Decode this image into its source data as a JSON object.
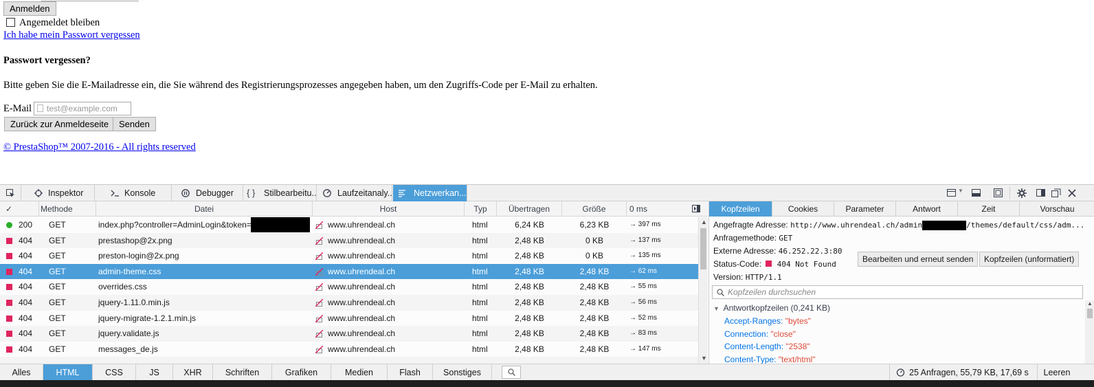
{
  "page": {
    "login_button": "Anmelden",
    "remember_label": "Angemeldet bleiben",
    "forgot_link": "Ich habe mein Passwort vergessen",
    "forgot_heading": "Passwort vergessen?",
    "forgot_text": "Bitte geben Sie die E-Mailadresse ein, die Sie während des Registrierungsprozesses angegeben haben, um den Zugriffs-Code per E-Mail zu erhalten.",
    "email_label": "E-Mail",
    "email_placeholder": "test@example.com",
    "back_button": "Zurück zur Anmeldeseite",
    "send_button": "Senden",
    "footer_link": "© PrestaShop™ 2007-2016 - All rights reserved"
  },
  "devtools": {
    "tabs": [
      "Inspektor",
      "Konsole",
      "Debugger",
      "Stilbearbeitu...",
      "Laufzeitanaly...",
      "Netzwerkan..."
    ],
    "active_tab": "Netzwerkan...",
    "columns": {
      "check": "✓",
      "method": "Methode",
      "file": "Datei",
      "host": "Host",
      "type": "Typ",
      "transferred": "Übertragen",
      "size": "Größe",
      "waterfall": "0 ms"
    },
    "requests": [
      {
        "status": "200",
        "method": "GET",
        "file": "index.php?controller=AdminLogin&token=",
        "host": "www.uhrendeal.ch",
        "type": "html",
        "transferred": "6,24 KB",
        "size": "6,23 KB",
        "time": "→ 397 ms"
      },
      {
        "status": "404",
        "method": "GET",
        "file": "prestashop@2x.png",
        "host": "www.uhrendeal.ch",
        "type": "html",
        "transferred": "2,48 KB",
        "size": "0 KB",
        "time": "→ 137 ms"
      },
      {
        "status": "404",
        "method": "GET",
        "file": "preston-login@2x.png",
        "host": "www.uhrendeal.ch",
        "type": "html",
        "transferred": "2,48 KB",
        "size": "0 KB",
        "time": "→ 135 ms"
      },
      {
        "status": "404",
        "method": "GET",
        "file": "admin-theme.css",
        "host": "www.uhrendeal.ch",
        "type": "html",
        "transferred": "2,48 KB",
        "size": "2,48 KB",
        "time": "→ 62 ms"
      },
      {
        "status": "404",
        "method": "GET",
        "file": "overrides.css",
        "host": "www.uhrendeal.ch",
        "type": "html",
        "transferred": "2,48 KB",
        "size": "2,48 KB",
        "time": "→ 55 ms"
      },
      {
        "status": "404",
        "method": "GET",
        "file": "jquery-1.11.0.min.js",
        "host": "www.uhrendeal.ch",
        "type": "html",
        "transferred": "2,48 KB",
        "size": "2,48 KB",
        "time": "→ 56 ms"
      },
      {
        "status": "404",
        "method": "GET",
        "file": "jquery-migrate-1.2.1.min.js",
        "host": "www.uhrendeal.ch",
        "type": "html",
        "transferred": "2,48 KB",
        "size": "2,48 KB",
        "time": "→ 52 ms"
      },
      {
        "status": "404",
        "method": "GET",
        "file": "jquery.validate.js",
        "host": "www.uhrendeal.ch",
        "type": "html",
        "transferred": "2,48 KB",
        "size": "2,48 KB",
        "time": "→ 83 ms"
      },
      {
        "status": "404",
        "method": "GET",
        "file": "messages_de.js",
        "host": "www.uhrendeal.ch",
        "type": "html",
        "transferred": "2,48 KB",
        "size": "2,48 KB",
        "time": "→ 147 ms"
      }
    ],
    "details": {
      "tabs": [
        "Kopfzeilen",
        "Cookies",
        "Parameter",
        "Antwort",
        "Zeit",
        "Vorschau"
      ],
      "active_tab": "Kopfzeilen",
      "request_url_label": "Angefragte Adresse:",
      "request_url_start": "http://www.uhrendeal.ch/admin",
      "request_url_end": "/themes/default/css/adm...",
      "method_label": "Anfragemethode:",
      "method_value": "GET",
      "remote_label": "Externe Adresse:",
      "remote_value": "46.252.22.3:80",
      "status_label": "Status-Code:",
      "status_value": "404 Not Found",
      "version_label": "Version:",
      "version_value": "HTTP/1.1",
      "edit_resend_button": "Bearbeiten und erneut senden",
      "raw_headers_button": "Kopfzeilen (unformatiert)",
      "filter_placeholder": "Kopfzeilen durchsuchen",
      "response_headers_label": "Antwortkopfzeilen (0,241 KB)",
      "headers": [
        {
          "key": "Accept-Ranges:",
          "value": "\"bytes\""
        },
        {
          "key": "Connection:",
          "value": "\"close\""
        },
        {
          "key": "Content-Length:",
          "value": "\"2538\""
        },
        {
          "key": "Content-Type:",
          "value": "\"text/html\""
        }
      ]
    },
    "filters": [
      "Alles",
      "HTML",
      "CSS",
      "JS",
      "XHR",
      "Schriften",
      "Grafiken",
      "Medien",
      "Flash",
      "Sonstiges"
    ],
    "active_filter": "HTML",
    "summary": "25 Anfragen, 55,79 KB, 17,69 s",
    "clear_button": "Leeren"
  },
  "colors": {
    "accent": "#4c9ed9",
    "status_ok": "#2ab02a",
    "status_error": "#e0245e",
    "link": "#0000ee"
  }
}
